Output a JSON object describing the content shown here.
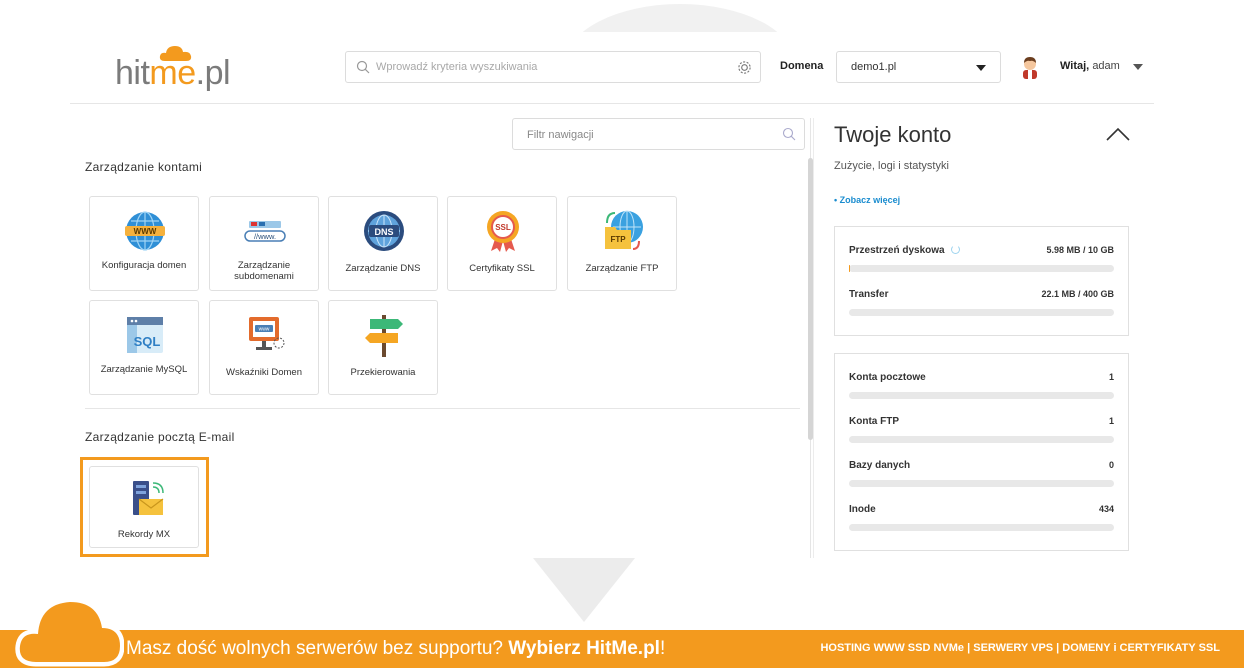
{
  "header": {
    "logo": {
      "part1": "hit",
      "part2": "me",
      "part3": ".pl"
    },
    "search_placeholder": "Wprowadź kryteria wyszukiwania",
    "domain_label": "Domena",
    "domain_value": "demo1.pl",
    "greeting_bold": "Witaj,",
    "username": "adam"
  },
  "nav": {
    "filter_placeholder": "Filtr nawigacji",
    "sections": [
      {
        "title": "Zarządzanie kontami",
        "items": [
          {
            "label": "Konfiguracja domen",
            "icon": "www-globe-icon"
          },
          {
            "label": "Zarządzanie subdomenami",
            "icon": "subdomain-icon"
          },
          {
            "label": "Zarządzanie DNS",
            "icon": "dns-globe-icon"
          },
          {
            "label": "Certyfikaty SSL",
            "icon": "ssl-badge-icon"
          },
          {
            "label": "Zarządzanie FTP",
            "icon": "ftp-icon"
          },
          {
            "label": "Zarządzanie MySQL",
            "icon": "sql-database-icon"
          },
          {
            "label": "Wskaźniki Domen",
            "icon": "domain-pointer-icon"
          },
          {
            "label": "Przekierowania",
            "icon": "signpost-icon"
          }
        ]
      },
      {
        "title": "Zarządzanie pocztą E-mail",
        "items": [
          {
            "label": "Rekordy MX",
            "icon": "mx-server-mail-icon"
          }
        ]
      }
    ]
  },
  "account": {
    "title": "Twoje konto",
    "subtitle": "Zużycie, logi i statystyki",
    "more_link": "• Zobacz więcej",
    "usage": [
      {
        "label": "Przestrzeń dyskowa",
        "value": "5.98 MB / 10 GB",
        "fraction": 0.0006
      },
      {
        "label": "Transfer",
        "value": "22.1 MB / 400 GB",
        "fraction": 0.0001
      }
    ],
    "counts": [
      {
        "label": "Konta pocztowe",
        "value": "1"
      },
      {
        "label": "Konta FTP",
        "value": "1"
      },
      {
        "label": "Bazy danych",
        "value": "0"
      },
      {
        "label": "Inode",
        "value": "434"
      }
    ]
  },
  "footer": {
    "message": "Masz dość wolnych serwerów bez supportu?",
    "cta": "Wybierz HitMe.pl",
    "cta_suffix": "!",
    "services": "HOSTING WWW SSD NVMe | SERWERY VPS | DOMENY i CERTYFIKATY SSL"
  },
  "colors": {
    "accent": "#f39a1e",
    "link": "#1a8ccf"
  }
}
